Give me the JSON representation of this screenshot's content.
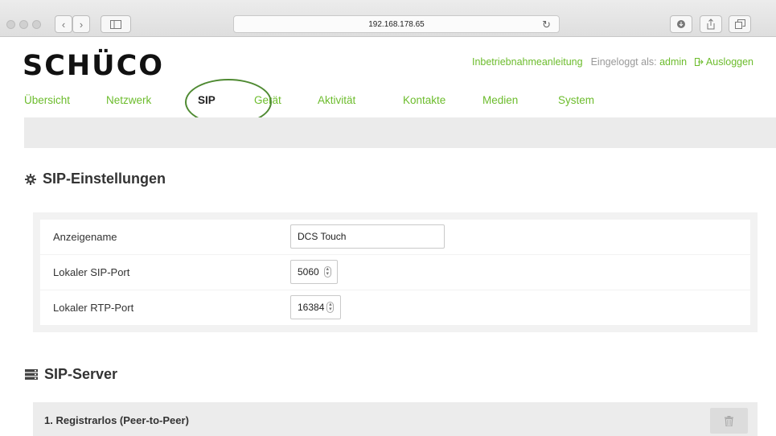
{
  "browser": {
    "url": "192.168.178.65",
    "back_glyph": "‹",
    "forward_glyph": "›",
    "reload_glyph": "↻"
  },
  "header": {
    "logo": "SCHÜCO",
    "guide_link": "Inbetriebnahmeanleitung",
    "logged_in_prefix": "Eingeloggt als:",
    "logged_in_user": "admin",
    "logout": "Ausloggen"
  },
  "nav": {
    "items": [
      {
        "label": "Übersicht",
        "active": false
      },
      {
        "label": "Netzwerk",
        "active": false
      },
      {
        "label": "SIP",
        "active": true
      },
      {
        "label": "Gerät",
        "active": false
      },
      {
        "label": "Aktivität",
        "active": false
      },
      {
        "label": "Kontakte",
        "active": false
      },
      {
        "label": "Medien",
        "active": false
      },
      {
        "label": "System",
        "active": false
      }
    ]
  },
  "sip_settings": {
    "title": "SIP-Einstellungen",
    "rows": [
      {
        "label": "Anzeigename",
        "value": "DCS Touch"
      },
      {
        "label": "Lokaler SIP-Port",
        "value": "5060"
      },
      {
        "label": "Lokaler RTP-Port",
        "value": "16384"
      }
    ]
  },
  "sip_server": {
    "title": "SIP-Server",
    "entries": [
      {
        "label": "1. Registrarlos (Peer-to-Peer)"
      }
    ]
  },
  "colors": {
    "accent": "#6cbc2c",
    "annotation_circle": "#4f8a32"
  },
  "icons": [
    "gear-icon",
    "server-icon",
    "trash-icon",
    "logout-icon"
  ]
}
